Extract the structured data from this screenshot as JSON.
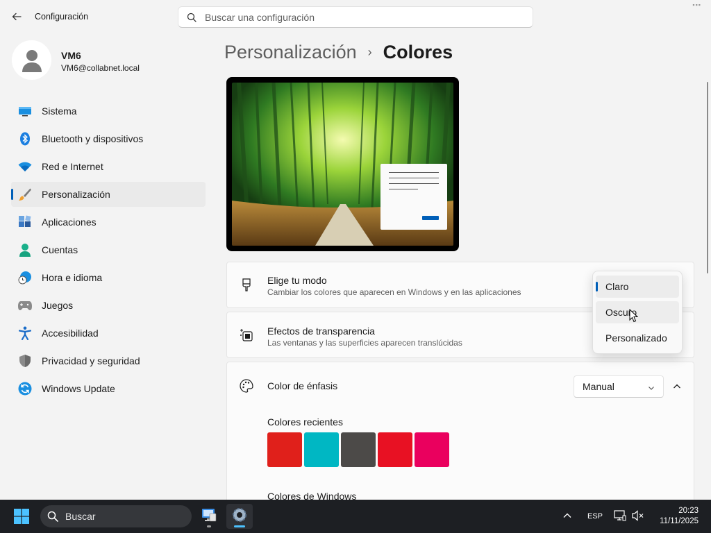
{
  "window": {
    "app_title": "Configuración",
    "search_placeholder": "Buscar una configuración"
  },
  "user": {
    "name": "VM6",
    "email": "VM6@collabnet.local"
  },
  "sidebar": {
    "items": [
      {
        "label": "Sistema",
        "icon": "system-icon"
      },
      {
        "label": "Bluetooth y dispositivos",
        "icon": "bluetooth-icon"
      },
      {
        "label": "Red e Internet",
        "icon": "wifi-icon"
      },
      {
        "label": "Personalización",
        "icon": "brush-icon",
        "active": true
      },
      {
        "label": "Aplicaciones",
        "icon": "apps-icon"
      },
      {
        "label": "Cuentas",
        "icon": "account-icon"
      },
      {
        "label": "Hora e idioma",
        "icon": "clock-globe-icon"
      },
      {
        "label": "Juegos",
        "icon": "gamepad-icon"
      },
      {
        "label": "Accesibilidad",
        "icon": "accessibility-icon"
      },
      {
        "label": "Privacidad y seguridad",
        "icon": "shield-icon"
      },
      {
        "label": "Windows Update",
        "icon": "update-icon"
      }
    ]
  },
  "breadcrumb": {
    "parent": "Personalización",
    "separator": "›",
    "current": "Colores"
  },
  "settings": {
    "mode": {
      "title": "Elige tu modo",
      "subtitle": "Cambiar los colores que aparecen en Windows y en las aplicaciones"
    },
    "transparency": {
      "title": "Efectos de transparencia",
      "subtitle": "Las ventanas y las superficies aparecen translúcidas"
    },
    "accent": {
      "title": "Color de énfasis",
      "dropdown_value": "Manual",
      "recent_label": "Colores recientes",
      "recent_colors": [
        "#e0201b",
        "#00b7c3",
        "#4c4a48",
        "#e81123",
        "#ea005e"
      ],
      "windows_colors_label": "Colores de Windows"
    }
  },
  "mode_menu": {
    "options": [
      "Claro",
      "Oscuro",
      "Personalizado"
    ],
    "selected": "Claro",
    "hovered": "Oscuro"
  },
  "taskbar": {
    "search_placeholder": "Buscar",
    "language": "ESP",
    "time": "20:23",
    "date": "11/11/2025"
  },
  "colors": {
    "accent": "#005fb8",
    "window_bg": "#f3f3f3",
    "taskbar_bg": "#1d1f23"
  }
}
